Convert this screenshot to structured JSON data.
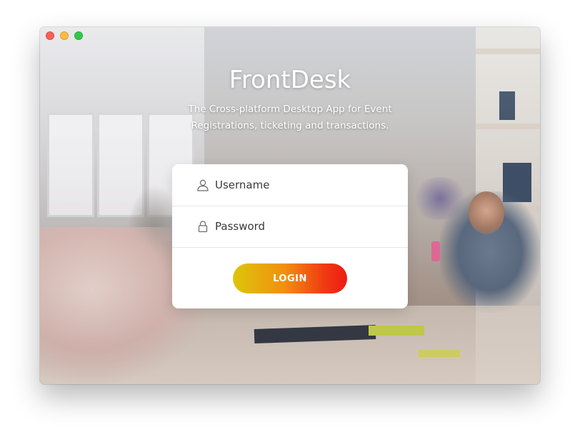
{
  "window": {
    "controls": [
      "close",
      "minimize",
      "zoom"
    ]
  },
  "app": {
    "title": "FrontDesk",
    "subtitle": "The Cross-platform Desktop App for Event Registrations, ticketing and transactions."
  },
  "login": {
    "username_placeholder": "Username",
    "password_placeholder": "Password",
    "login_button": "LOGIN",
    "username_icon": "user-icon",
    "password_icon": "lock-icon"
  },
  "colors": {
    "button_gradient_start": "#dcc60a",
    "button_gradient_end": "#ee1b14",
    "close": "#fc605b",
    "minimize": "#fdbc40",
    "zoom": "#34c84a"
  }
}
